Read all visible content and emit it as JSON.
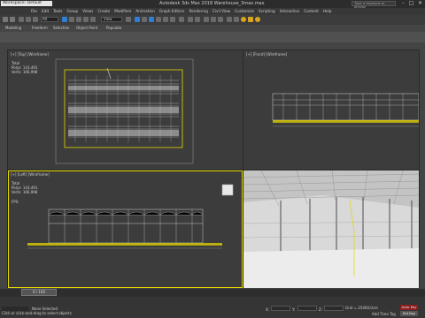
{
  "window": {
    "workspace": "Workspace: Default",
    "title": "Autodesk 3ds Max 2018    Warehouse_3max.max",
    "search_placeholder": "Type a keyword or phrase",
    "minimize": "–",
    "maximize": "□",
    "close": "✕"
  },
  "menu": [
    "File",
    "Edit",
    "Tools",
    "Group",
    "Views",
    "Create",
    "Modifiers",
    "Animation",
    "Graph Editors",
    "Rendering",
    "Civil View",
    "Customize",
    "Scripting",
    "Interactive",
    "Content",
    "Help"
  ],
  "toolbar": {
    "selection_filter": "All",
    "view_dropdown": "View"
  },
  "ribbon": {
    "tabs": [
      "Modeling",
      "Freeform",
      "Selection",
      "Object Paint",
      "Populate"
    ],
    "polygon_modeling": "Polygon Modeling"
  },
  "viewports": {
    "top": {
      "label": "[+] [Top] [Wireframe]",
      "stats_title": "Total",
      "polys_label": "Polys:",
      "polys_value": "143,491",
      "verts_label": "Verts:",
      "verts_value": "166,998"
    },
    "front": {
      "label": "[+] [Front] [Wireframe]"
    },
    "left": {
      "label": "[+] [Left] [Wireframe]",
      "stats_title": "Total",
      "polys_label": "Polys:",
      "polys_value": "143,491",
      "verts_label": "Verts:",
      "verts_value": "166,998",
      "fps": "FPS:"
    },
    "persp": {
      "label": "[+] [Perspective] [Realistic]"
    }
  },
  "timeline": {
    "frame": "0 / 100"
  },
  "status": {
    "selection": "None Selected",
    "prompt": "Click or click-and-drag to select objects",
    "x_label": "X:",
    "y_label": "Y:",
    "z_label": "Z:",
    "grid": "Grid = 25400,0cm",
    "add_time_tag": "Add Time Tag",
    "auto_key": "Auto Key",
    "set_key": "Set Key",
    "selected": "Selected",
    "key_filters": "Key Filters..."
  },
  "colors": {
    "accent_yellow": "#e5d600",
    "toolbar_blue": "#2f7fd6",
    "viewport_bg": "#3c3c3c"
  }
}
